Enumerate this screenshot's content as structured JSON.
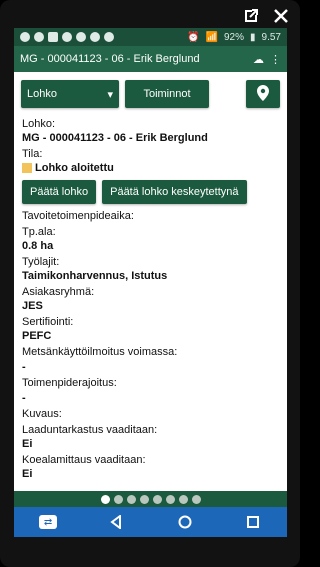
{
  "status_bar": {
    "battery": "92%",
    "time": "9.57"
  },
  "app_bar": {
    "title": "MG - 000041123 - 06 - Erik Berglund"
  },
  "toolbar": {
    "lohko_label": "Lohko",
    "toiminnot_label": "Toiminnot"
  },
  "content": {
    "lohko_label": "Lohko:",
    "lohko_value": "MG - 000041123 - 06 - Erik Berglund",
    "tila_label": "Tila:",
    "tila_value": "Lohko aloitettu",
    "paata_lohko_label": "Päätä lohko",
    "paata_keskeytetty_label": "Päätä lohko keskeytettynä",
    "tavoite_label": "Tavoitetoimenpideaika:",
    "tpala_label": "Tp.ala:",
    "tpala_value": "0.8 ha",
    "tyolajit_label": "Työlajit:",
    "tyolajit_value": "Taimikonharvennus, Istutus",
    "asiakasryhma_label": "Asiakasryhmä:",
    "asiakasryhma_value": "JES",
    "sertifiointi_label": "Sertifiointi:",
    "sertifiointi_value": "PEFC",
    "metsankaytto_label": "Metsänkäyttöilmoitus voimassa:",
    "metsankaytto_value": "-",
    "toimenpiderajoitus_label": "Toimenpiderajoitus:",
    "toimenpiderajoitus_value": "-",
    "kuvaus_label": "Kuvaus:",
    "laaduntarkastus_label": "Laaduntarkastus vaaditaan:",
    "laaduntarkastus_value": "Ei",
    "koealamittaus_label": "Koealamittaus vaaditaan:",
    "koealamittaus_value": "Ei"
  },
  "pager": {
    "count": 8,
    "active_index": 0
  },
  "colors": {
    "statusbar": "#1b4f3a",
    "appbar": "#23664a",
    "button": "#1c5a40",
    "navbar": "#1d67b8",
    "tila_square": "#f2c35a"
  }
}
